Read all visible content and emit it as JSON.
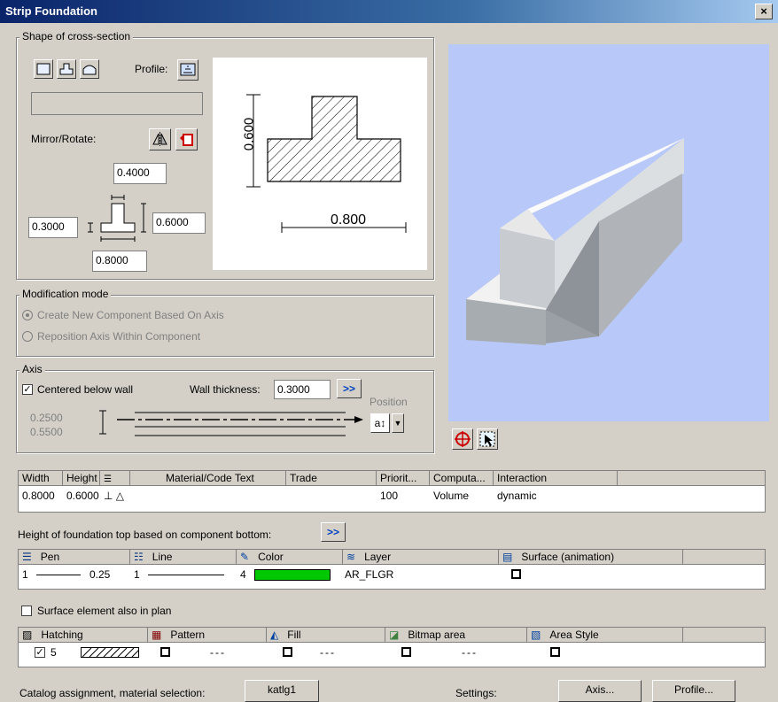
{
  "window": {
    "title": "Strip Foundation",
    "close_label": "×"
  },
  "shape": {
    "group_label": "Shape of cross-section",
    "profile_label": "Profile:",
    "mirror_label": "Mirror/Rotate:",
    "top_width": "0.4000",
    "left_height": "0.3000",
    "right_height": "0.6000",
    "bottom_width": "0.8000",
    "preview_height": "0.600",
    "preview_width": "0.800"
  },
  "modification": {
    "group_label": "Modification mode",
    "option1": "Create New Component Based On Axis",
    "option2": "Reposition Axis Within Component"
  },
  "axis": {
    "group_label": "Axis",
    "centered_label": "Centered below wall",
    "wall_thickness_label": "Wall thickness:",
    "wall_thickness_value": "0.3000",
    "expand_label": ">>",
    "position_label": "Position",
    "position_value": "a↕",
    "offset1": "0.2500",
    "offset2": "0.5500"
  },
  "properties_table": {
    "headers": [
      "Width",
      "Height",
      "",
      "Material/Code Text",
      "Trade",
      "Priorit...",
      "Computa...",
      "Interaction"
    ],
    "row": {
      "width": "0.8000",
      "height": "0.6000",
      "symbols": "⊥ △",
      "material": "",
      "trade": "",
      "priority": "100",
      "computation": "Volume",
      "interaction": "dynamic"
    }
  },
  "height_top": {
    "label": "Height of foundation top based on component bottom:",
    "button": ">>"
  },
  "format_table": {
    "headers": [
      "Pen",
      "Line",
      "Color",
      "Layer",
      "Surface (animation)"
    ],
    "row": {
      "pen": "1",
      "pen_width": "0.25",
      "line": "1",
      "color_index": "4",
      "color_hex": "#00c800",
      "layer": "AR_FLGR"
    }
  },
  "surface_plan": {
    "label": "Surface element also in plan",
    "checked": false
  },
  "hatch_table": {
    "headers": [
      "Hatching",
      "Pattern",
      "Fill",
      "Bitmap area",
      "Area Style"
    ],
    "row": {
      "hatching": "5",
      "pattern_dash": "---",
      "fill_dash": "---",
      "bitmap_dash": "---"
    }
  },
  "footer": {
    "catalog_label": "Catalog assignment, material selection:",
    "catalog_button": "katlg1",
    "settings_label": "Settings:",
    "axis_button": "Axis...",
    "profile_button": "Profile..."
  },
  "colors": {
    "titlebar": "#0a246a",
    "preview_bg": "#b8c8f8",
    "dialog_bg": "#d4d0c8"
  }
}
